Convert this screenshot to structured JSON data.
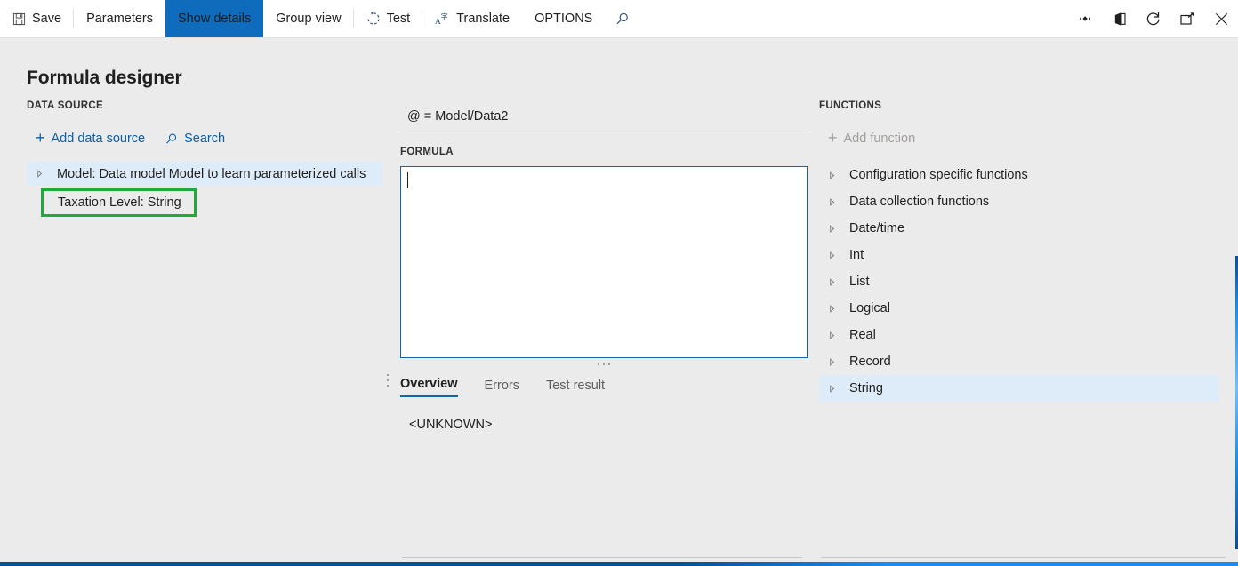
{
  "toolbar": {
    "items": [
      {
        "label": "Save",
        "icon": "save-icon",
        "active": false,
        "separator": true
      },
      {
        "label": "Parameters",
        "icon": "",
        "active": false,
        "separator": true
      },
      {
        "label": "Show details",
        "icon": "",
        "active": true,
        "separator": false
      },
      {
        "label": "Group view",
        "icon": "",
        "active": false,
        "separator": true
      },
      {
        "label": "Test",
        "icon": "refresh-dashed-icon",
        "active": false,
        "separator": true
      },
      {
        "label": "Translate",
        "icon": "translate-icon",
        "active": false,
        "separator": false
      },
      {
        "label": "OPTIONS",
        "icon": "",
        "active": false,
        "separator": false
      }
    ],
    "search_icon": "search-icon",
    "right_icons": [
      "diamond-settings-icon",
      "office-app-icon",
      "refresh-icon",
      "popout-icon",
      "close-icon"
    ],
    "accent_color": "#0f6cbd"
  },
  "page": {
    "title": "Formula designer"
  },
  "data_source": {
    "caption": "DATA SOURCE",
    "add_label": "Add data source",
    "add_icon": "plus-icon",
    "search_label": "Search",
    "search_icon": "search-icon",
    "tree": [
      {
        "label": "Model: Data model Model to learn parameterized calls",
        "selected": true,
        "expandable": true,
        "chevron": "chevron-right-icon"
      }
    ],
    "highlighted_node": {
      "label": "Taxation Level: String",
      "highlight_color": "#1faa3e"
    }
  },
  "formula": {
    "binding": "@ = Model/Data2",
    "caption": "FORMULA",
    "value": "",
    "tabs": [
      {
        "label": "Overview",
        "active": true
      },
      {
        "label": "Errors",
        "active": false
      },
      {
        "label": "Test result",
        "active": false
      }
    ],
    "overview_text": "<UNKNOWN>"
  },
  "functions": {
    "caption": "FUNCTIONS",
    "add_label": "Add function",
    "add_icon": "plus-icon",
    "categories": [
      {
        "label": "Configuration specific functions",
        "selected": false
      },
      {
        "label": "Data collection functions",
        "selected": false
      },
      {
        "label": "Date/time",
        "selected": false
      },
      {
        "label": "Int",
        "selected": false
      },
      {
        "label": "List",
        "selected": false
      },
      {
        "label": "Logical",
        "selected": false
      },
      {
        "label": "Real",
        "selected": false
      },
      {
        "label": "Record",
        "selected": false
      },
      {
        "label": "String",
        "selected": true
      }
    ]
  }
}
